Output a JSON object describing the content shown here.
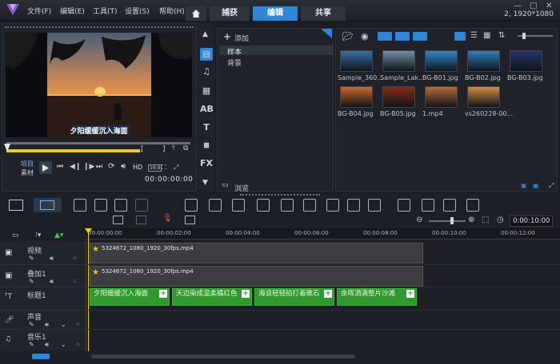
{
  "menu": [
    "文件(F)",
    "编辑(E)",
    "工具(T)",
    "设置(S)",
    "帮助(H)"
  ],
  "tabs": {
    "capture": "捕获",
    "edit": "编辑",
    "share": "共享"
  },
  "resolution": "2, 1920*1080",
  "preview": {
    "subtitle": "夕阳缓缓沉入海面",
    "mode_project": "项目",
    "mode_clip": "素材",
    "hd": "HD",
    "timecode": "00:00:00:00",
    "ratio": "16:9"
  },
  "library": {
    "add_label": "添加",
    "folders": [
      "样本",
      "背景"
    ],
    "browse_label": "浏览",
    "thumbnails": [
      {
        "name": "Sample_360...",
        "color": "#3b6fa3"
      },
      {
        "name": "Sample_Lak...",
        "color": "#6e8fa8"
      },
      {
        "name": "BG-B01.jpg",
        "color": "#2d87c8"
      },
      {
        "name": "BG-B02.jpg",
        "color": "#2e7fc0"
      },
      {
        "name": "BG-B03.jpg",
        "color": "#23356b"
      },
      {
        "name": "BG-B04.jpg",
        "color": "#c86a2a"
      },
      {
        "name": "BG-B05.jpg",
        "color": "#8a2a18"
      },
      {
        "name": "1.mp4",
        "color": "#b86a3a"
      },
      {
        "name": "vs260228-00...",
        "color": "#d28a40"
      }
    ]
  },
  "timeline": {
    "zoom_timecode": "0:00:10:00",
    "ruler": [
      "00:00:00:00",
      "00:00:02:00",
      "00:00:04:00",
      "00:00:06:00",
      "00:00:08:00",
      "00:00:10:00",
      "00:00:12:00"
    ],
    "tracks": [
      "视频",
      "叠加1",
      "标题1",
      "声音",
      "音乐1"
    ],
    "video_clip": "5324672_1080_1920_30fps.mp4",
    "overlay_clip": "5324672_1080_1920_30fps.mp4",
    "titles": [
      "夕阳缓缓沉入海面",
      "天边染成温柔橘红色",
      "海浪轻轻拍打着礁石",
      "余晖洒满整片沙滩"
    ]
  }
}
